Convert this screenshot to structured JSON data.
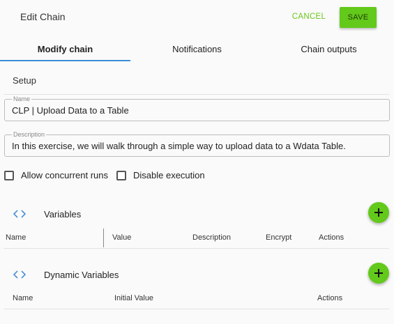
{
  "header": {
    "title": "Edit Chain",
    "cancel_label": "CANCEL",
    "save_label": "SAVE"
  },
  "tabs": [
    {
      "label": "Modify chain",
      "active": true
    },
    {
      "label": "Notifications",
      "active": false
    },
    {
      "label": "Chain outputs",
      "active": false
    }
  ],
  "setup": {
    "heading": "Setup",
    "name": {
      "label": "Name",
      "value": "CLP | Upload Data to a Table"
    },
    "description": {
      "label": "Description",
      "value": "In this exercise, we will walk through a simple way to upload data to a Wdata Table."
    },
    "options": [
      {
        "label": "Allow concurrent runs",
        "checked": false
      },
      {
        "label": "Disable execution",
        "checked": false
      }
    ]
  },
  "variables": {
    "heading": "Variables",
    "columns": [
      "Name",
      "Value",
      "Description",
      "Encrypt",
      "Actions"
    ]
  },
  "dynamic_variables": {
    "heading": "Dynamic Variables",
    "columns": [
      "Name",
      "Initial Value",
      "Actions"
    ]
  },
  "colors": {
    "accent_green": "#63c91a",
    "tab_indicator": "#3b8ed8",
    "code_icon": "#4a90d9"
  }
}
